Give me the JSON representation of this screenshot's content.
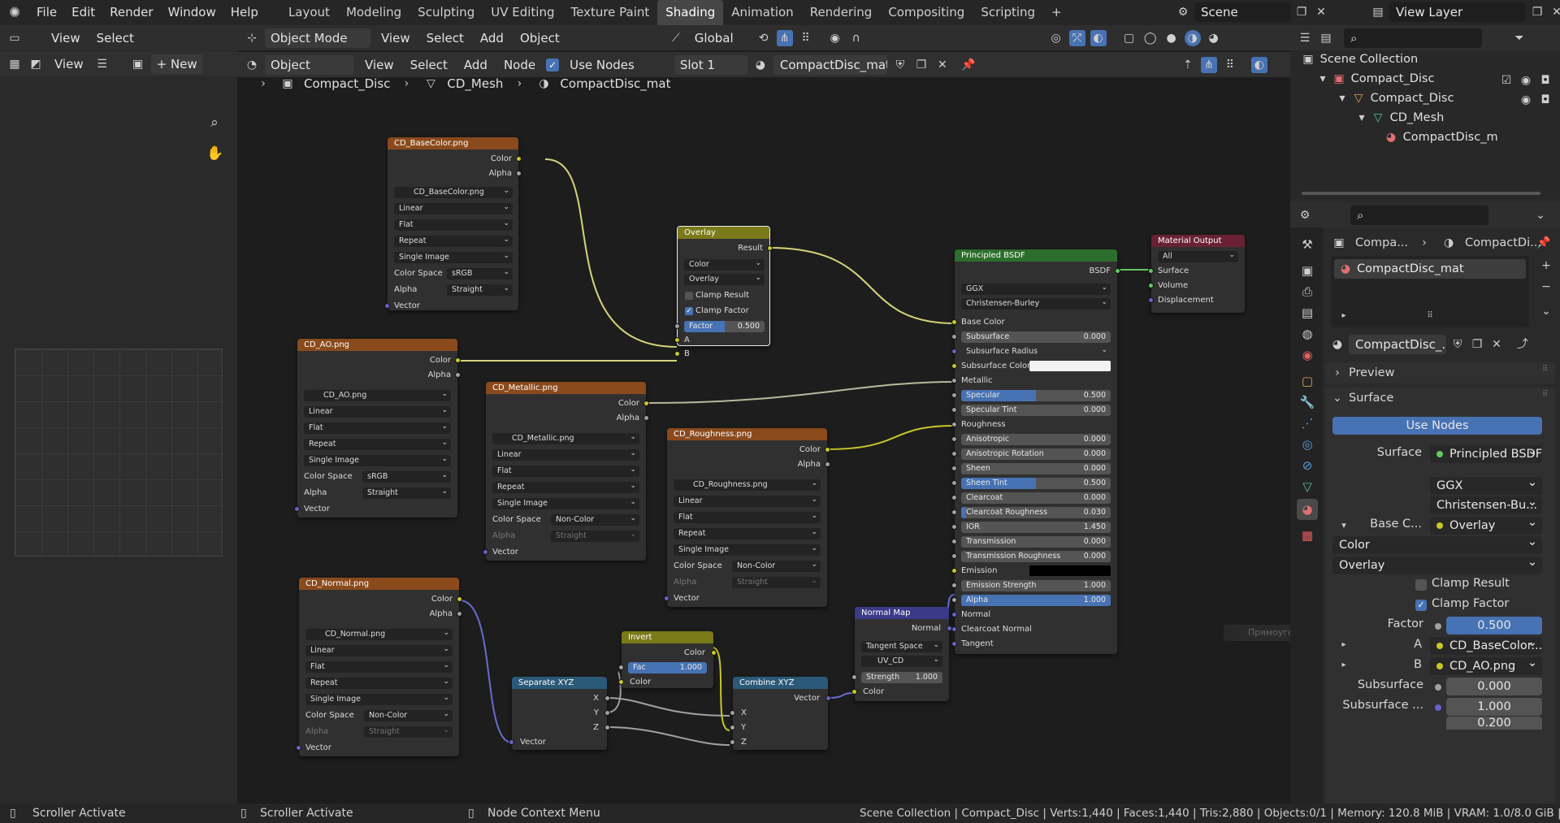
{
  "topbar": {
    "menus": [
      "File",
      "Edit",
      "Render",
      "Window",
      "Help"
    ],
    "workspaces": [
      "Layout",
      "Modeling",
      "Sculpting",
      "UV Editing",
      "Texture Paint",
      "Shading",
      "Animation",
      "Rendering",
      "Compositing",
      "Scripting"
    ],
    "active_workspace": "Shading",
    "add_tab": "+",
    "scene": "Scene",
    "view_layer": "View Layer"
  },
  "left_header": {
    "view": "View",
    "select": "Select",
    "image_view": "View",
    "new": "New",
    "new_plus": "+"
  },
  "viewport_header": {
    "mode": "Object Mode",
    "view": "View",
    "select": "Select",
    "add": "Add",
    "object": "Object",
    "orientation": "Global"
  },
  "node_header": {
    "object": "Object",
    "view": "View",
    "select": "Select",
    "add": "Add",
    "node": "Node",
    "use_nodes": "Use Nodes",
    "slot": "Slot 1",
    "material": "CompactDisc_mat"
  },
  "breadcrumb": [
    "Compact_Disc",
    "CD_Mesh",
    "CompactDisc_mat"
  ],
  "nodes": {
    "base_color": {
      "title": "CD_BaseColor.png",
      "out_color": "Color",
      "out_alpha": "Alpha",
      "image": "CD_BaseColor.png",
      "interp": "Linear",
      "proj": "Flat",
      "ext": "Repeat",
      "src": "Single Image",
      "cs_label": "Color Space",
      "cs": "sRGB",
      "alpha_label": "Alpha",
      "alpha": "Straight",
      "vector": "Vector"
    },
    "ao": {
      "title": "CD_AO.png",
      "out_color": "Color",
      "out_alpha": "Alpha",
      "image": "CD_AO.png",
      "interp": "Linear",
      "proj": "Flat",
      "ext": "Repeat",
      "src": "Single Image",
      "cs_label": "Color Space",
      "cs": "sRGB",
      "alpha_label": "Alpha",
      "alpha": "Straight",
      "vector": "Vector"
    },
    "metallic": {
      "title": "CD_Metallic.png",
      "out_color": "Color",
      "out_alpha": "Alpha",
      "image": "CD_Metallic.png",
      "interp": "Linear",
      "proj": "Flat",
      "ext": "Repeat",
      "src": "Single Image",
      "cs_label": "Color Space",
      "cs": "Non-Color",
      "alpha_label": "Alpha",
      "alpha": "Straight",
      "vector": "Vector"
    },
    "roughness": {
      "title": "CD_Roughness.png",
      "out_color": "Color",
      "out_alpha": "Alpha",
      "image": "CD_Roughness.png",
      "interp": "Linear",
      "proj": "Flat",
      "ext": "Repeat",
      "src": "Single Image",
      "cs_label": "Color Space",
      "cs": "Non-Color",
      "alpha_label": "Alpha",
      "alpha": "Straight",
      "vector": "Vector"
    },
    "normal": {
      "title": "CD_Normal.png",
      "out_color": "Color",
      "out_alpha": "Alpha",
      "image": "CD_Normal.png",
      "interp": "Linear",
      "proj": "Flat",
      "ext": "Repeat",
      "src": "Single Image",
      "cs_label": "Color Space",
      "cs": "Non-Color",
      "alpha_label": "Alpha",
      "alpha": "Straight",
      "vector": "Vector"
    },
    "overlay": {
      "title": "Overlay",
      "result": "Result",
      "type": "Color",
      "blend": "Overlay",
      "clamp_result": "Clamp Result",
      "clamp_factor": "Clamp Factor",
      "factor_label": "Factor",
      "factor": "0.500",
      "a": "A",
      "b": "B"
    },
    "bsdf": {
      "title": "Principled BSDF",
      "out": "BSDF",
      "dist": "GGX",
      "sss": "Christensen-Burley",
      "rows": [
        {
          "label": "Base Color",
          "kind": "socket"
        },
        {
          "label": "Subsurface",
          "value": "0.000",
          "kind": "slider",
          "fill": 0
        },
        {
          "label": "Subsurface Radius",
          "kind": "select"
        },
        {
          "label": "Subsurface Color",
          "kind": "color"
        },
        {
          "label": "Metallic",
          "kind": "socket"
        },
        {
          "label": "Specular",
          "value": "0.500",
          "kind": "slider",
          "fill": 0.5
        },
        {
          "label": "Specular Tint",
          "value": "0.000",
          "kind": "slider",
          "fill": 0
        },
        {
          "label": "Roughness",
          "kind": "socket"
        },
        {
          "label": "Anisotropic",
          "value": "0.000",
          "kind": "slider",
          "fill": 0
        },
        {
          "label": "Anisotropic Rotation",
          "value": "0.000",
          "kind": "slider",
          "fill": 0
        },
        {
          "label": "Sheen",
          "value": "0.000",
          "kind": "slider",
          "fill": 0
        },
        {
          "label": "Sheen Tint",
          "value": "0.500",
          "kind": "slider",
          "fill": 0.5
        },
        {
          "label": "Clearcoat",
          "value": "0.000",
          "kind": "slider",
          "fill": 0
        },
        {
          "label": "Clearcoat Roughness",
          "value": "0.030",
          "kind": "slider",
          "fill": 0.03
        },
        {
          "label": "IOR",
          "value": "1.450",
          "kind": "slider",
          "fill": 0
        },
        {
          "label": "Transmission",
          "value": "0.000",
          "kind": "slider",
          "fill": 0
        },
        {
          "label": "Transmission Roughness",
          "value": "0.000",
          "kind": "slider",
          "fill": 0
        },
        {
          "label": "Emission",
          "kind": "black"
        },
        {
          "label": "Emission Strength",
          "value": "1.000",
          "kind": "slider",
          "fill": 0
        },
        {
          "label": "Alpha",
          "value": "1.000",
          "kind": "slider",
          "fill": 1
        },
        {
          "label": "Normal",
          "kind": "socket"
        },
        {
          "label": "Clearcoat Normal",
          "kind": "socket"
        },
        {
          "label": "Tangent",
          "kind": "socket"
        }
      ]
    },
    "output": {
      "title": "Material Output",
      "target": "All",
      "surface": "Surface",
      "volume": "Volume",
      "displacement": "Displacement"
    },
    "separate": {
      "title": "Separate XYZ",
      "x": "X",
      "y": "Y",
      "z": "Z",
      "vector": "Vector"
    },
    "invert": {
      "title": "Invert",
      "out": "Color",
      "fac_label": "Fac",
      "fac": "1.000",
      "color": "Color"
    },
    "combine": {
      "title": "Combine XYZ",
      "out": "Vector",
      "x": "X",
      "y": "Y",
      "z": "Z"
    },
    "normal_map": {
      "title": "Normal Map",
      "out": "Normal",
      "space": "Tangent Space",
      "uv": "UV_CD",
      "strength_label": "Strength",
      "strength": "1.000",
      "color": "Color"
    }
  },
  "outliner": {
    "rows": [
      {
        "label": "Scene Collection"
      },
      {
        "label": "Compact_Disc"
      },
      {
        "label": "Compact_Disc"
      },
      {
        "label": "CD_Mesh"
      },
      {
        "label": "CompactDisc_m"
      }
    ]
  },
  "properties": {
    "crumb_object": "Compa...",
    "crumb_material": "CompactDi...",
    "slot_material": "CompactDisc_mat",
    "material_field": "CompactDisc_...",
    "preview": "Preview",
    "surface_panel": "Surface",
    "use_nodes": "Use Nodes",
    "surface_label": "Surface",
    "surface_value": "Principled BSDF",
    "dist": "GGX",
    "sss": "Christensen-Bu...",
    "base_label": "Base C...",
    "base_value": "Overlay",
    "type": "Color",
    "blend": "Overlay",
    "clamp_result": "Clamp Result",
    "clamp_factor": "Clamp Factor",
    "factor_label": "Factor",
    "factor": "0.500",
    "a_label": "A",
    "a_value": "CD_BaseColor....",
    "b_label": "B",
    "b_value": "CD_AO.png",
    "subsurface_label": "Subsurface",
    "subsurface": "0.000",
    "subsurface_r_label": "Subsurface ...",
    "subsurface_r1": "1.000",
    "subsurface_r2": "0.200",
    "tooltip": "Прямоугольник"
  },
  "status": {
    "left1": "Scroller Activate",
    "left2": "Scroller Activate",
    "middle": "Node Context Menu",
    "right": "Scene Collection | Compact_Disc | Verts:1,440 | Faces:1,440 | Tris:2,880 | Objects:0/1 | Memory: 120.8 MiB | VRAM: 1.0/8.0 GiB | 3.4.1"
  },
  "colors": {
    "accent": "#4772b3",
    "tex_header": "#8a4a1c",
    "shader_header": "#2c6e2c",
    "vector_header": "#2b5978"
  }
}
